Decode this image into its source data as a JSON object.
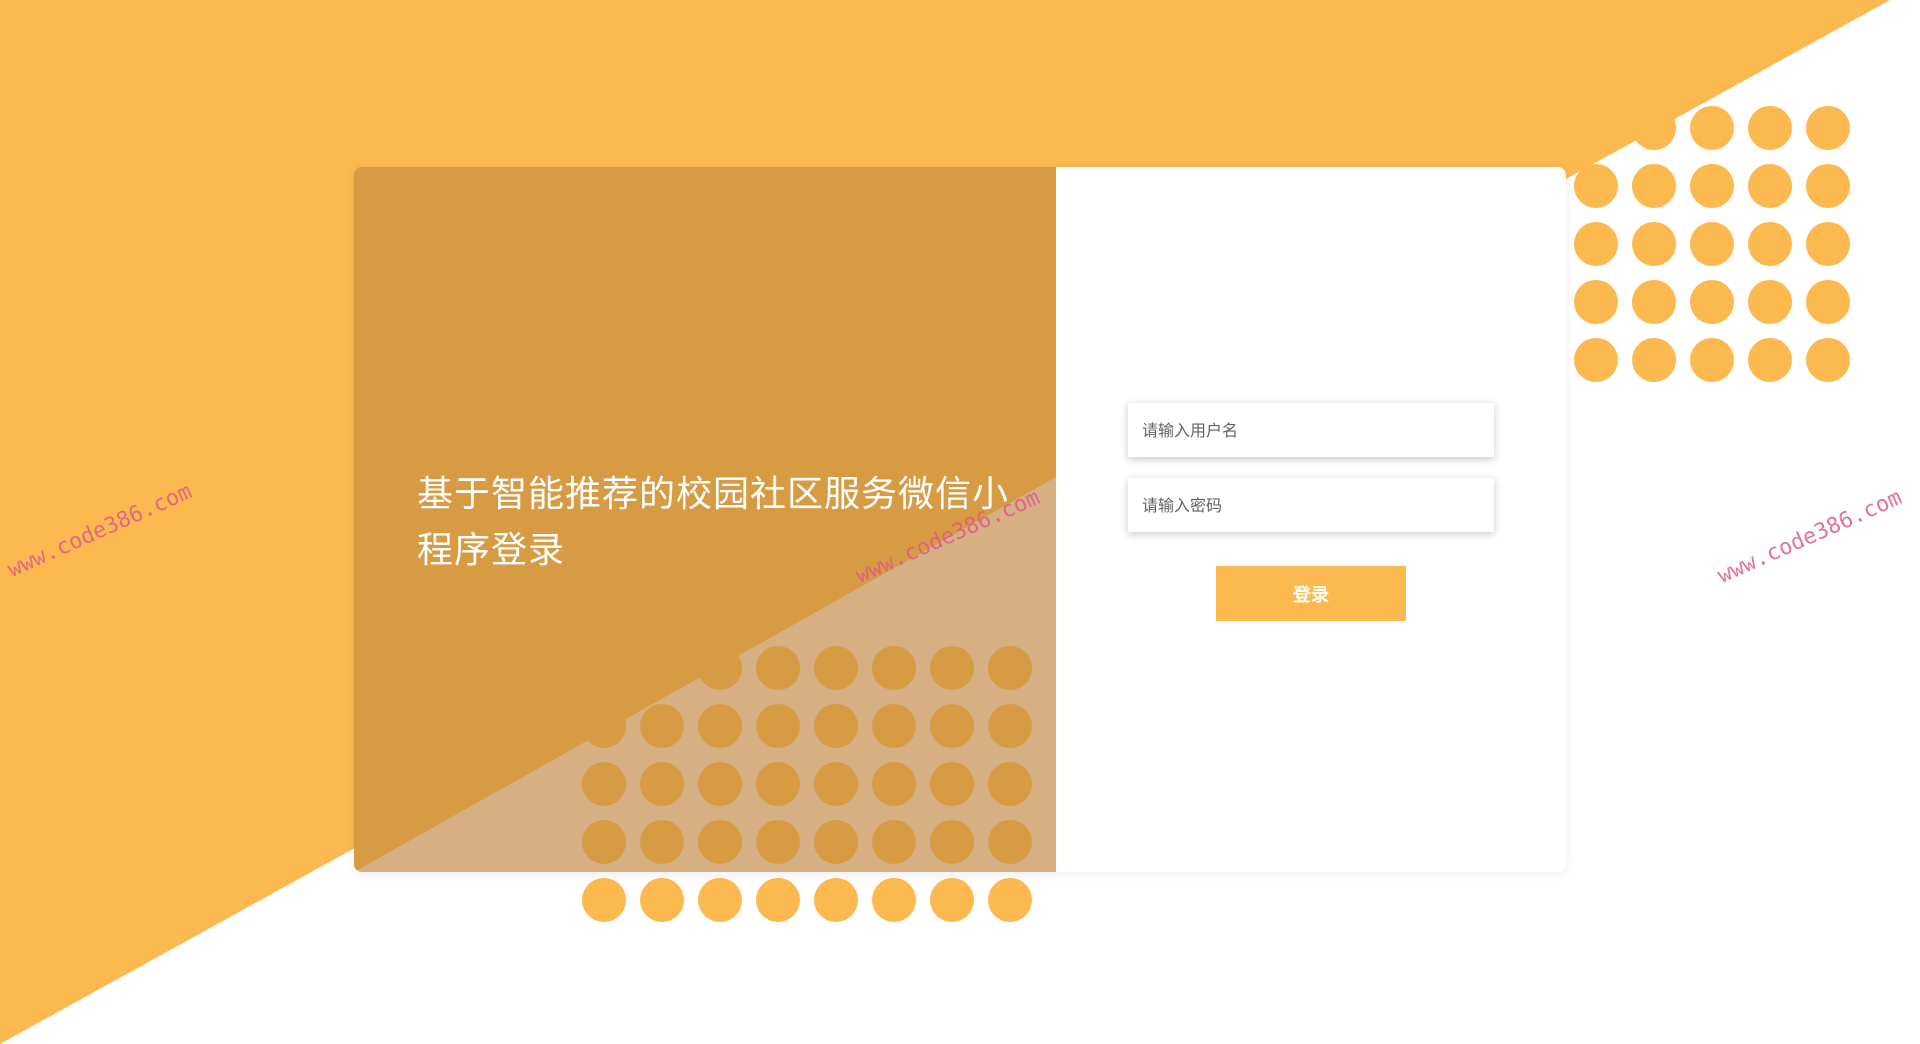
{
  "colors": {
    "primary_orange": "#fcb94f",
    "card_left_orange": "#d79b44",
    "card_left_light": "#d6b082",
    "white": "#ffffff",
    "watermark_pink": "#e05a8a"
  },
  "login": {
    "title": "基于智能推荐的校园社区服务微信小程序登录",
    "username_placeholder": "请输入用户名",
    "password_placeholder": "请输入密码",
    "login_button": "登录"
  },
  "watermarks": {
    "left": "www.code386.com",
    "middle": "www.code386.com",
    "right": "www.code386.com"
  }
}
